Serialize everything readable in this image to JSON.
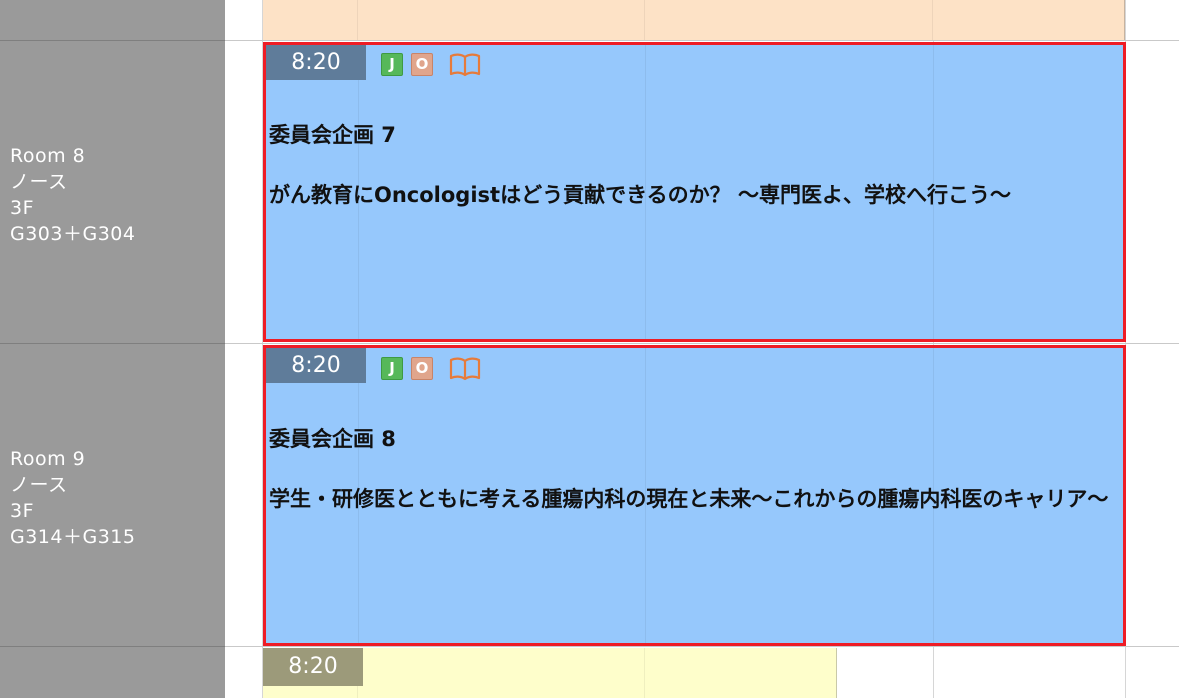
{
  "rooms": [
    {
      "name": "Room 8",
      "area": "ノース",
      "floor": "3F",
      "halls": "G303＋G304"
    },
    {
      "name": "Room 9",
      "area": "ノース",
      "floor": "3F",
      "halls": "G314＋G315"
    }
  ],
  "sessions": [
    {
      "time": "8:20",
      "badge_j": "J",
      "badge_o": "O",
      "book_icon": "open-book-icon",
      "title": "委員会企画 7",
      "subtitle": "がん教育にOncologistはどう貢献できるのか？ ～専門医よ、学校へ行こう～"
    },
    {
      "time": "8:20",
      "badge_j": "J",
      "badge_o": "O",
      "book_icon": "open-book-icon",
      "title": "委員会企画 8",
      "subtitle": "学生・研修医とともに考える腫瘍内科の現在と未来～これからの腫瘍内科医のキャリア～"
    }
  ],
  "next_session": {
    "time": "8:20"
  },
  "colors": {
    "room_column": "#9a9a9a",
    "session_blue": "#96c8fc",
    "session_orange": "#fde2c6",
    "session_yellow": "#fefecb",
    "time_badge_blue": "#5f7c9a",
    "time_badge_yellow": "#9c9a7a",
    "selected_border": "#ee1c25",
    "badge_j": "#56b85a",
    "badge_o": "#e0a58c",
    "book_icon": "#e67b3b"
  }
}
